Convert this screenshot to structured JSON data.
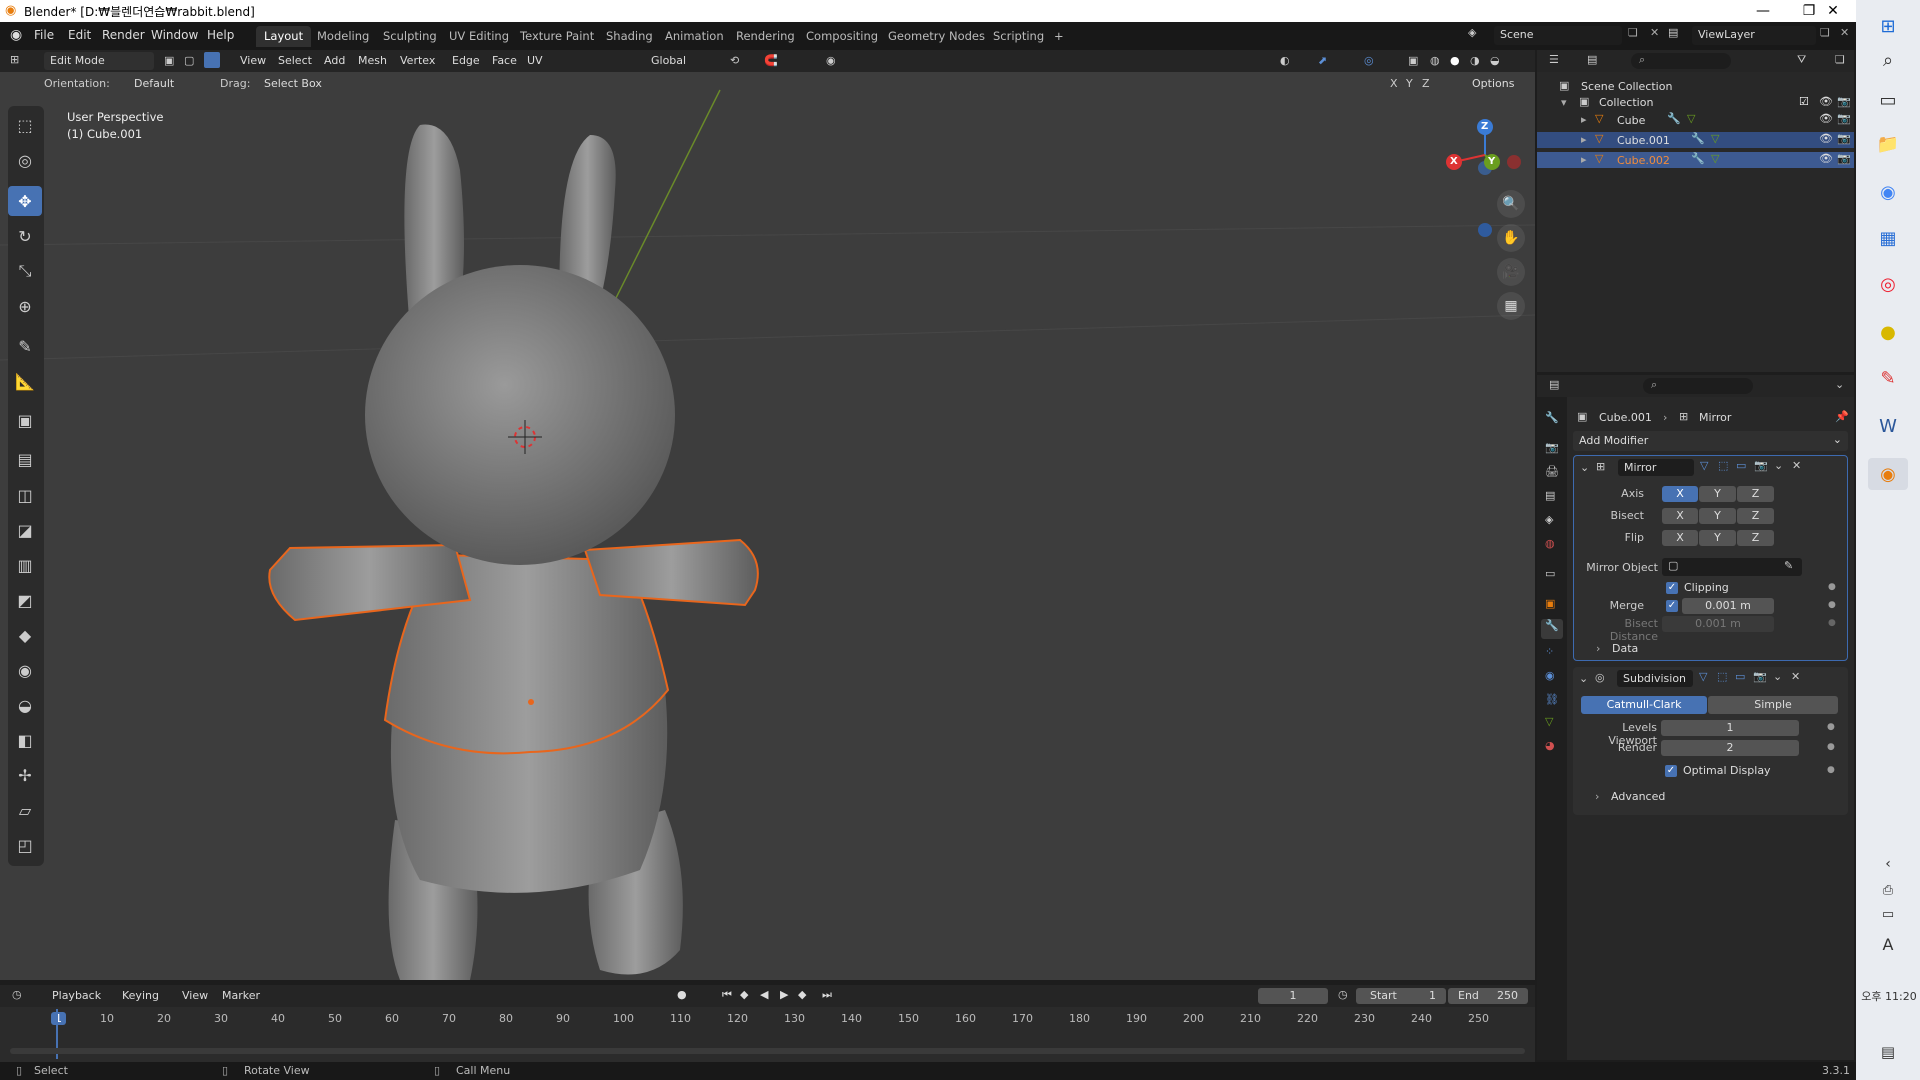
{
  "window": {
    "title": "Blender* [D:₩블렌더연습₩rabbit.blend]",
    "minimize": "—",
    "maximize": "❐",
    "close": "✕"
  },
  "menu": [
    "File",
    "Edit",
    "Render",
    "Window",
    "Help"
  ],
  "workspaces": [
    "Layout",
    "Modeling",
    "Sculpting",
    "UV Editing",
    "Texture Paint",
    "Shading",
    "Animation",
    "Rendering",
    "Compositing",
    "Geometry Nodes",
    "Scripting",
    "+"
  ],
  "scene": {
    "label": "Scene",
    "viewlayer": "ViewLayer"
  },
  "viewport_header": {
    "mode": "Edit Mode",
    "menus": [
      "View",
      "Select",
      "Add",
      "Mesh",
      "Vertex",
      "Edge",
      "Face",
      "UV"
    ],
    "transform": "Global"
  },
  "tool_header": {
    "orientation_label": "Orientation:",
    "orientation_value": "Default",
    "drag_label": "Drag:",
    "drag_value": "Select Box",
    "axes": [
      "X",
      "Y",
      "Z"
    ],
    "options": "Options"
  },
  "viewport": {
    "view_name": "User Perspective",
    "object_name": "(1) Cube.001"
  },
  "gizmo": {
    "x": "X",
    "y": "Y",
    "z": "Z"
  },
  "outliner": {
    "scene_collection": "Scene Collection",
    "collection": "Collection",
    "items": [
      {
        "name": "Cube",
        "selected": false,
        "active": false
      },
      {
        "name": "Cube.001",
        "selected": true,
        "active": false
      },
      {
        "name": "Cube.002",
        "selected": true,
        "active": true
      }
    ]
  },
  "properties": {
    "breadcrumb_object": "Cube.001",
    "breadcrumb_modifier": "Mirror",
    "add_modifier": "Add Modifier",
    "mirror": {
      "name": "Mirror",
      "axis_label": "Axis",
      "bisect_label": "Bisect",
      "flip_label": "Flip",
      "x": "X",
      "y": "Y",
      "z": "Z",
      "mirror_object_label": "Mirror Object",
      "clipping_label": "Clipping",
      "merge_label": "Merge",
      "merge_value": "0.001 m",
      "bisect_distance_label": "Bisect Distance",
      "bisect_distance_value": "0.001 m",
      "data_label": "Data"
    },
    "subdivision": {
      "name": "Subdivision",
      "catmull": "Catmull-Clark",
      "simple": "Simple",
      "levels_label": "Levels Viewport",
      "levels_value": "1",
      "render_label": "Render",
      "render_value": "2",
      "optimal_label": "Optimal Display",
      "advanced_label": "Advanced"
    }
  },
  "timeline": {
    "menus": [
      "Playback",
      "Keying",
      "View",
      "Marker"
    ],
    "current_frame": "1",
    "start_label": "Start",
    "start_value": "1",
    "end_label": "End",
    "end_value": "250",
    "ruler": [
      "1",
      "10",
      "20",
      "30",
      "40",
      "50",
      "60",
      "70",
      "80",
      "90",
      "100",
      "110",
      "120",
      "130",
      "140",
      "150",
      "160",
      "170",
      "180",
      "190",
      "200",
      "210",
      "220",
      "230",
      "240",
      "250"
    ]
  },
  "statusbar": {
    "select": "Select",
    "rotate": "Rotate View",
    "callmenu": "Call Menu",
    "version": "3.3.1"
  },
  "taskbar": {
    "clock": "오후 11:20",
    "ime": "A"
  }
}
